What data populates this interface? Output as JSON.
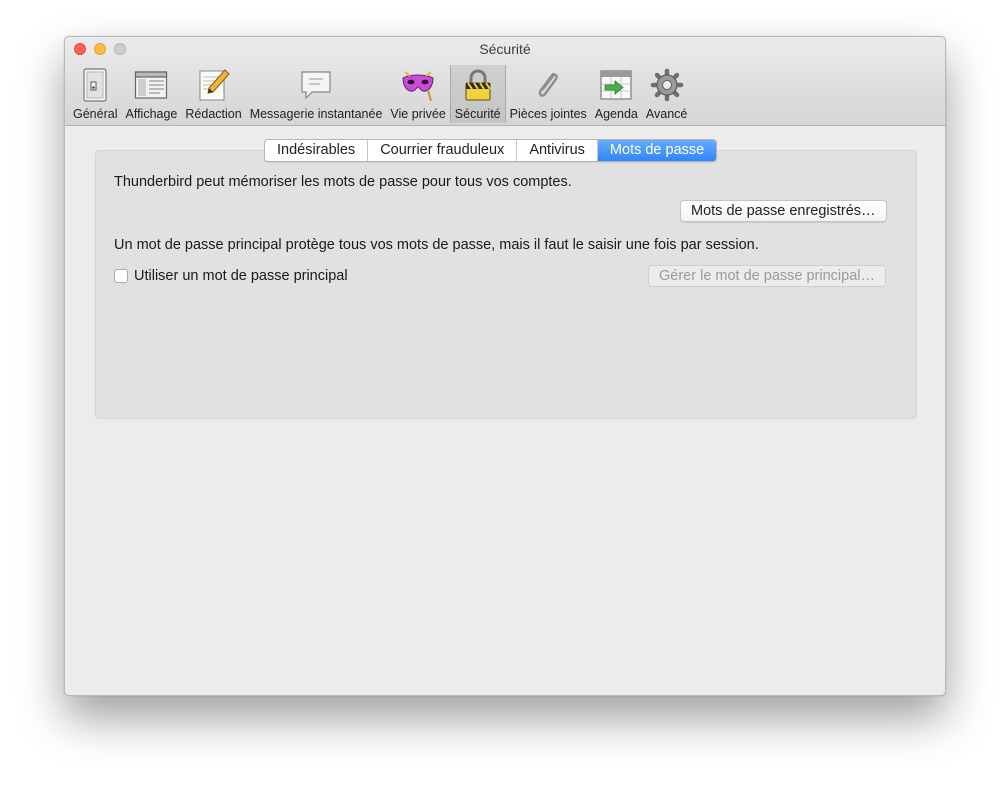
{
  "window": {
    "title": "Sécurité"
  },
  "toolbar": {
    "items": [
      {
        "label": "Général",
        "icon": "general-switch-icon"
      },
      {
        "label": "Affichage",
        "icon": "display-window-icon"
      },
      {
        "label": "Rédaction",
        "icon": "compose-pencil-icon"
      },
      {
        "label": "Messagerie instantanée",
        "icon": "chat-bubble-icon"
      },
      {
        "label": "Vie privée",
        "icon": "privacy-mask-icon"
      },
      {
        "label": "Sécurité",
        "icon": "security-padlock-icon",
        "selected": true
      },
      {
        "label": "Pièces jointes",
        "icon": "attachment-paperclip-icon"
      },
      {
        "label": "Agenda",
        "icon": "calendar-icon"
      },
      {
        "label": "Avancé",
        "icon": "advanced-gear-icon"
      }
    ]
  },
  "tabs": [
    {
      "label": "Indésirables"
    },
    {
      "label": "Courrier frauduleux"
    },
    {
      "label": "Antivirus"
    },
    {
      "label": "Mots de passe",
      "active": true
    }
  ],
  "passwords": {
    "description": "Thunderbird peut mémoriser les mots de passe pour tous vos comptes.",
    "saved_button": "Mots de passe enregistrés…",
    "master_description": "Un mot de passe principal protège tous vos mots de passe, mais il faut le saisir une fois par session.",
    "master_checkbox_label": "Utiliser un mot de passe principal",
    "master_checkbox_checked": false,
    "manage_master_button": "Gérer le mot de passe principal…"
  },
  "colors": {
    "accent_tab": "#3a8ef9",
    "close": "#fc605b",
    "minimize": "#fdbc40",
    "zoom": "#cdcdcd"
  }
}
